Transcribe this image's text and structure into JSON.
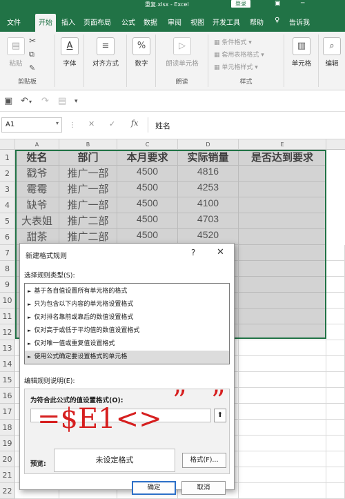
{
  "title_bar": {
    "title": "重复.xlsx - Excel",
    "login": "登录"
  },
  "tabs": [
    "文件",
    "开始",
    "插入",
    "页面布局",
    "公式",
    "数据",
    "审阅",
    "视图",
    "开发工具",
    "帮助",
    "告诉我"
  ],
  "ribbon": {
    "clipboard": {
      "paste": "粘贴",
      "group": "剪贴板"
    },
    "font": {
      "label": "字体"
    },
    "alignment": {
      "label": "对齐方式"
    },
    "number": {
      "label": "数字",
      "icon_text": "%"
    },
    "read": {
      "button": "朗读单元格",
      "group": "朗读"
    },
    "styles": {
      "conditional": "条件格式",
      "table": "套用表格格式",
      "cell": "单元格样式",
      "group": "样式"
    },
    "cells": {
      "label": "单元格"
    },
    "editing": {
      "label": "编辑"
    }
  },
  "formula_bar": {
    "name_box": "A1",
    "content": "姓名"
  },
  "columns": [
    "A",
    "B",
    "C",
    "D",
    "E"
  ],
  "rows": [
    "1",
    "2",
    "3",
    "4",
    "5",
    "6",
    "7",
    "8",
    "9",
    "10",
    "11",
    "12",
    "13",
    "14",
    "15",
    "16",
    "17",
    "18",
    "19",
    "20",
    "21",
    "22"
  ],
  "table": {
    "headers": [
      "姓名",
      "部门",
      "本月要求",
      "实际销量",
      "是否达到要求"
    ],
    "rows": [
      [
        "戳爷",
        "推广一部",
        "4500",
        "4816",
        ""
      ],
      [
        "霉霉",
        "推广一部",
        "4500",
        "4253",
        ""
      ],
      [
        "缺爷",
        "推广一部",
        "4500",
        "4100",
        ""
      ],
      [
        "大表姐",
        "推广二部",
        "4500",
        "4703",
        ""
      ],
      [
        "甜茶",
        "推广二部",
        "4500",
        "4520",
        ""
      ]
    ]
  },
  "dialog": {
    "title": "新建格式规则",
    "help": "?",
    "close": "✕",
    "select_type_label": "选择规则类型(S):",
    "rule_types": [
      "基于各自值设置所有单元格的格式",
      "只为包含以下内容的单元格设置格式",
      "仅对排名靠前或靠后的数值设置格式",
      "仅对高于或低于平均值的数值设置格式",
      "仅对唯一值或重复值设置格式",
      "使用公式确定要设置格式的单元格"
    ],
    "edit_desc_label": "编辑规则说明(E):",
    "formula_label": "为符合此公式的值设置格式(O):",
    "formula_value": "",
    "preview_label": "预览:",
    "preview_text": "未设定格式",
    "format_button": "格式(F)...",
    "ok": "确定",
    "cancel": "取消"
  },
  "annotation": {
    "formula": "=$E1<>",
    "quote_open": "”",
    "quote_close": "”"
  }
}
